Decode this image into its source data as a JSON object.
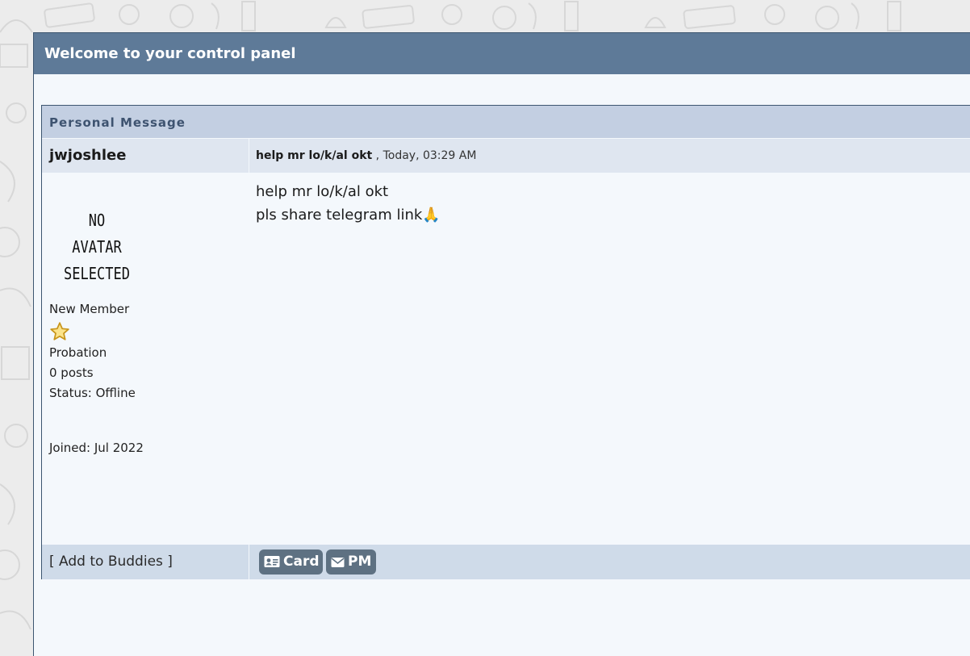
{
  "header": {
    "title": "Welcome to your control panel"
  },
  "message": {
    "section_title": "Personal Message",
    "author": "jwjoshlee",
    "subject": "help mr lo/k/al okt",
    "date_sep": " , ",
    "date": "Today, 03:29 AM",
    "avatar_line1": "NO AVATAR",
    "avatar_line2": "SELECTED",
    "body_line1": "help mr lo/k/al okt",
    "body_line2": "pls share telegram link",
    "body_emoji": "🙏"
  },
  "user": {
    "rank": "New Member",
    "group": "Probation",
    "posts": "0 posts",
    "status": "Status: Offline",
    "joined": "Joined: Jul 2022"
  },
  "footer": {
    "add_buddies": "[ Add to Buddies ]",
    "card_label": "Card",
    "pm_label": "PM"
  },
  "colors": {
    "header_bg": "#5e7a98",
    "title_bar_bg": "#c3cfe2",
    "button_bg": "#5e7182",
    "star": "#e8b923"
  },
  "icons": [
    "star-icon",
    "id-card-icon",
    "envelope-icon",
    "folded-hands-emoji"
  ]
}
